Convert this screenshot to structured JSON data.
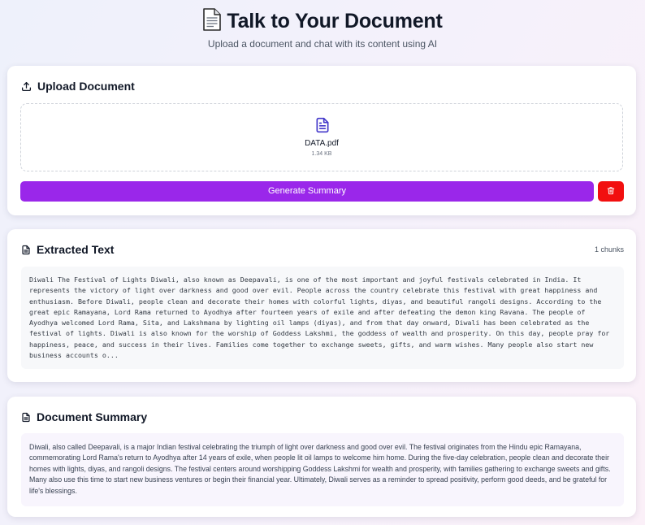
{
  "header": {
    "title": "Talk to Your Document",
    "subtitle": "Upload a document and chat with its content using AI",
    "title_icon": "document-icon"
  },
  "upload": {
    "title": "Upload Document",
    "icon": "upload-icon",
    "file_icon": "file-text-icon",
    "file_name": "DATA.pdf",
    "file_size": "1.34 KB",
    "generate_label": "Generate Summary",
    "delete_icon": "trash-icon"
  },
  "extracted": {
    "title": "Extracted Text",
    "icon": "file-text-icon",
    "chunks": "1 chunks",
    "text": "Diwali The Festival of Lights Diwali, also known as Deepavali, is one of the most important and joyful festivals celebrated in India. It represents the victory of light over darkness and good over evil. People across the country celebrate this festival with great happiness and enthusiasm. Before Diwali, people clean and decorate their homes with colorful lights, diyas, and beautiful rangoli designs. According to the great epic Ramayana, Lord Rama returned to Ayodhya after fourteen years of exile and after defeating the demon king Ravana. The people of Ayodhya welcomed Lord Rama, Sita, and Lakshmana by lighting oil lamps (diyas), and from that day onward, Diwali has been celebrated as the festival of lights. Diwali is also known for the worship of Goddess Lakshmi, the goddess of wealth and prosperity. On this day, people pray for happiness, peace, and success in their lives. Families come together to exchange sweets, gifts, and warm wishes. Many people also start new business accounts o..."
  },
  "summary": {
    "title": "Document Summary",
    "icon": "file-text-icon",
    "text": "Diwali, also called Deepavali, is a major Indian festival celebrating the triumph of light over darkness and good over evil. The festival originates from the Hindu epic Ramayana, commemorating Lord Rama's return to Ayodhya after 14 years of exile, when people lit oil lamps to welcome him home. During the five-day celebration, people clean and decorate their homes with lights, diyas, and rangoli designs. The festival centers around worshipping Goddess Lakshmi for wealth and prosperity, with families gathering to exchange sweets and gifts. Many also use this time to start new business ventures or begin their financial year. Ultimately, Diwali serves as a reminder to spread positivity, perform good deeds, and be grateful for life's blessings."
  },
  "colors": {
    "generate_button": "#9a27ea",
    "delete_button": "#f20f0f",
    "file_icon": "#4338ca"
  }
}
